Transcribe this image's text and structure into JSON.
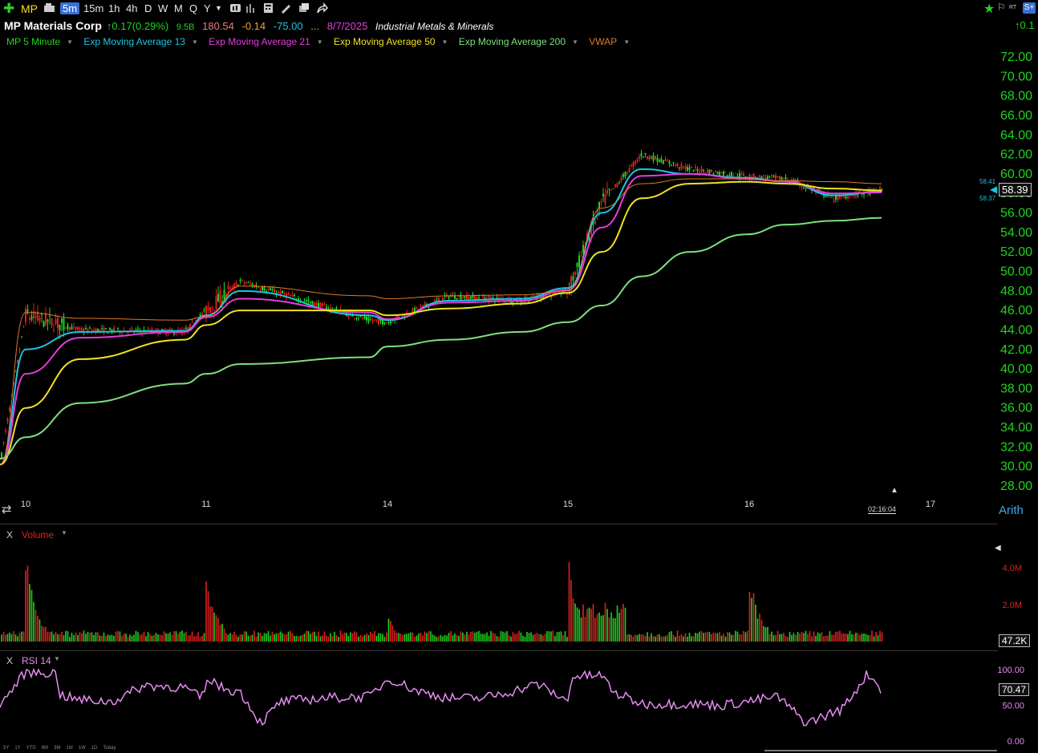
{
  "toolbar": {
    "symbol": "MP",
    "timeframes": [
      "5m",
      "15m",
      "1h",
      "4h",
      "D",
      "W",
      "M",
      "Q",
      "Y"
    ],
    "active_timeframe": "5m",
    "rt_label": "RT",
    "right_change": "0.1"
  },
  "header": {
    "company": "MP Materials Corp",
    "change": "0.17",
    "change_pct": "(0.29%)",
    "market_cap": "9.5B",
    "pe": "180.54",
    "eps": "-0.14",
    "other": "-75.00",
    "ellipsis": "...",
    "earnings_date": "8/7/2025",
    "industry": "Industrial Metals & Minerals"
  },
  "studies": [
    {
      "label": "MP 5 Minute",
      "color": "#1ed41e"
    },
    {
      "label": "Exp Moving Average 13",
      "color": "#19c6e6"
    },
    {
      "label": "Exp Moving Average 21",
      "color": "#e53be0"
    },
    {
      "label": "Exp Moving Average 50",
      "color": "#f2e21e"
    },
    {
      "label": "Exp Moving Average 200",
      "color": "#7de07d"
    },
    {
      "label": "VWAP",
      "color": "#e0782a"
    }
  ],
  "price_axis": {
    "ticks": [
      "72.00",
      "70.00",
      "68.00",
      "66.00",
      "64.00",
      "62.00",
      "60.00",
      "58.00",
      "56.00",
      "54.00",
      "52.00",
      "50.00",
      "48.00",
      "46.00",
      "44.00",
      "42.00",
      "40.00",
      "38.00",
      "36.00",
      "34.00",
      "32.00",
      "30.00",
      "28.00"
    ],
    "last_price": "58.39",
    "bid": "58.41",
    "ask": "58.37",
    "scale": "Arith"
  },
  "time_axis": {
    "labels": [
      "10",
      "11",
      "14",
      "15",
      "16",
      "17"
    ],
    "countdown": "02:16:04"
  },
  "volume_panel": {
    "close_label": "X",
    "label": "Volume",
    "ticks": [
      "4.0M",
      "2.0M"
    ],
    "last_value": "47.2K"
  },
  "rsi_panel": {
    "close_label": "X",
    "label": "RSI 14",
    "ticks": [
      "100.00",
      "50.00",
      "0.00"
    ],
    "last_value": "70.47"
  },
  "range_buttons": [
    "5Y",
    "1Y",
    "YTD",
    "6M",
    "3M",
    "1M",
    "1W",
    "1D",
    "Today"
  ],
  "colors": {
    "up": "#1ed41e",
    "down": "#e02020",
    "ema13": "#19c6e6",
    "ema21": "#e53be0",
    "ema50": "#f2e21e",
    "ema200": "#7de07d",
    "vwap": "#e0782a",
    "rsi": "#e58cf0",
    "axis_text": "#1ed41e"
  },
  "chart_data": {
    "type": "line",
    "ylim": [
      28,
      72
    ],
    "x": [
      "10",
      "10",
      "10",
      "10",
      "11",
      "11",
      "11",
      "14",
      "14",
      "14",
      "15",
      "15",
      "15",
      "15",
      "16",
      "16",
      "16",
      "16"
    ],
    "series": [
      {
        "name": "MP 5 Minute",
        "values": [
          30.2,
          45.5,
          44.0,
          43.8,
          46.0,
          49.0,
          45.0,
          44.8,
          47.5,
          47.0,
          48.0,
          57.0,
          62.0,
          60.5,
          59.8,
          59.5,
          57.5,
          58.39
        ]
      },
      {
        "name": "Exp Moving Average 13",
        "values": [
          30.2,
          42.0,
          43.8,
          43.9,
          45.5,
          48.0,
          45.5,
          45.0,
          47.0,
          47.2,
          48.3,
          56.0,
          60.5,
          60.0,
          59.6,
          59.2,
          57.8,
          58.2
        ]
      },
      {
        "name": "Exp Moving Average 21",
        "values": [
          30.2,
          39.5,
          43.2,
          43.8,
          45.3,
          47.2,
          45.8,
          45.1,
          46.8,
          47.0,
          48.1,
          54.5,
          59.8,
          60.0,
          59.5,
          59.2,
          58.0,
          58.1
        ]
      },
      {
        "name": "Exp Moving Average 50",
        "values": [
          30.2,
          36.0,
          41.0,
          43.0,
          44.5,
          46.0,
          46.0,
          45.5,
          46.2,
          46.7,
          47.8,
          52.0,
          57.5,
          59.0,
          59.2,
          59.0,
          58.5,
          58.3
        ]
      },
      {
        "name": "Exp Moving Average 200",
        "values": [
          30.8,
          33.0,
          36.5,
          38.5,
          39.5,
          40.5,
          41.2,
          42.3,
          43.0,
          43.8,
          44.8,
          46.5,
          49.5,
          52.0,
          53.8,
          54.8,
          55.2,
          55.5
        ]
      },
      {
        "name": "VWAP",
        "values": [
          30.2,
          45.8,
          45.2,
          45.0,
          45.4,
          48.5,
          47.5,
          47.2,
          47.5,
          47.6,
          48.0,
          56.5,
          59.0,
          59.5,
          59.5,
          59.3,
          59.2,
          59.0
        ]
      }
    ]
  }
}
